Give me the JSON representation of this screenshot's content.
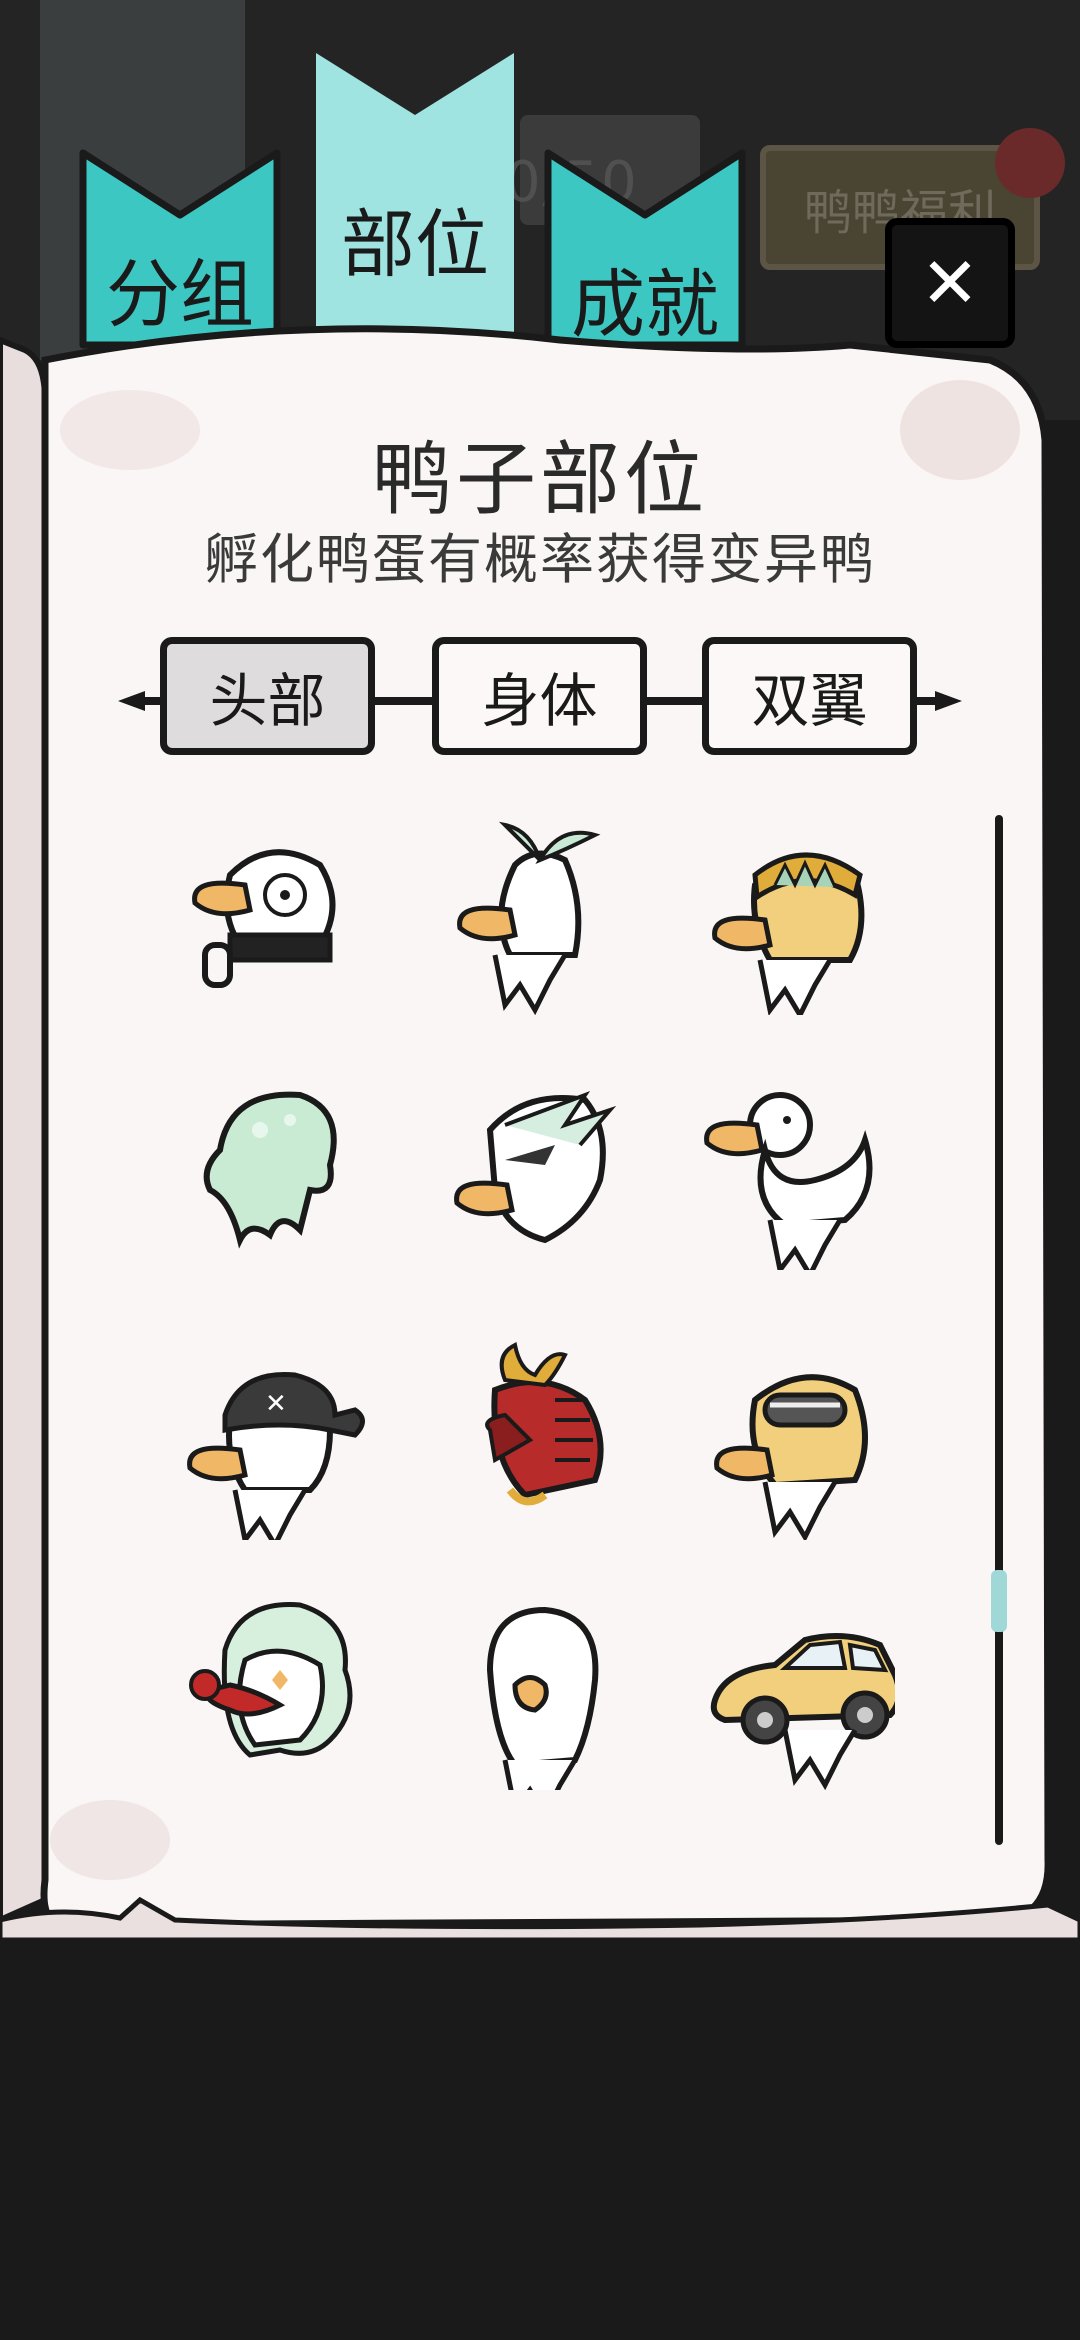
{
  "background": {
    "counter_text": "0/50",
    "welfare_label": "鸭鸭福利"
  },
  "tabs": [
    {
      "label": "分组",
      "color": "#3dc7c3",
      "active": false
    },
    {
      "label": "部位",
      "color": "#9fe4e0",
      "active": true
    },
    {
      "label": "成就",
      "color": "#3dc7c3",
      "active": false
    }
  ],
  "close_icon": "close-icon",
  "panel": {
    "title": "鸭子部位",
    "subtitle": "孵化鸭蛋有概率获得变异鸭"
  },
  "categories": [
    {
      "label": "头部",
      "active": true
    },
    {
      "label": "身体",
      "active": false
    },
    {
      "label": "双翼",
      "active": false
    }
  ],
  "scroll": {
    "position_fraction": 0.74
  },
  "parts": [
    {
      "icon": "zombie-duck-head-icon"
    },
    {
      "icon": "sprout-duck-head-icon"
    },
    {
      "icon": "viking-helmet-duck-head-icon"
    },
    {
      "icon": "slime-duck-head-icon"
    },
    {
      "icon": "feather-crest-duck-head-icon"
    },
    {
      "icon": "plain-duck-head-icon"
    },
    {
      "icon": "pirate-bandana-duck-head-icon"
    },
    {
      "icon": "samurai-armor-duck-head-icon"
    },
    {
      "icon": "racing-helmet-duck-head-icon"
    },
    {
      "icon": "clown-duck-head-icon"
    },
    {
      "icon": "hooded-duck-head-icon"
    },
    {
      "icon": "car-duck-head-icon"
    }
  ]
}
